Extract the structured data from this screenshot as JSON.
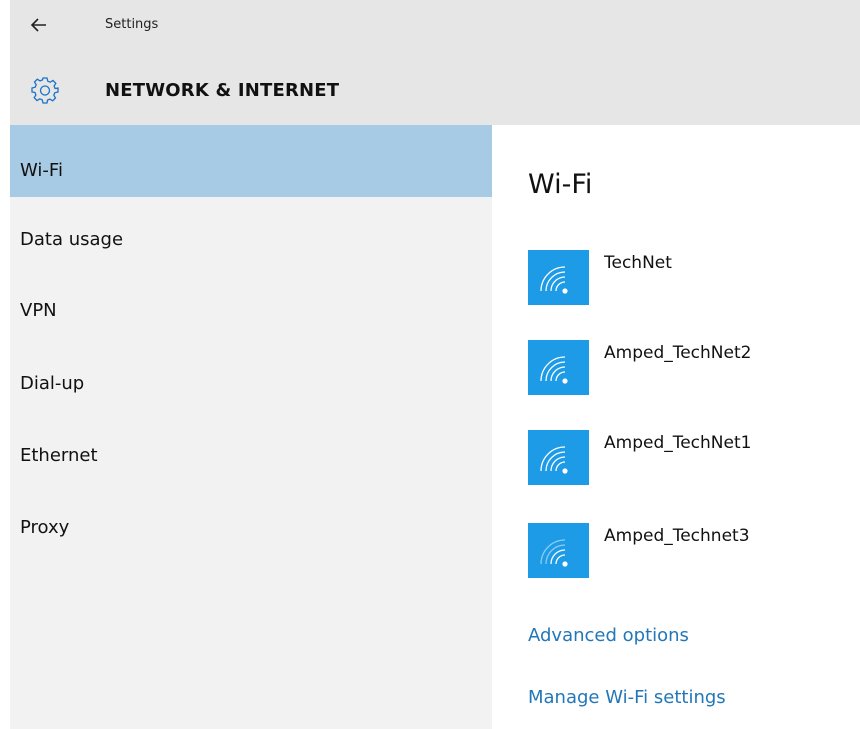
{
  "window": {
    "title": "Settings"
  },
  "header": {
    "page_title": "NETWORK & INTERNET"
  },
  "nav": {
    "items": [
      {
        "label": "Wi-Fi",
        "selected": true
      },
      {
        "label": "Data usage",
        "selected": false
      },
      {
        "label": "VPN",
        "selected": false
      },
      {
        "label": "Dial-up",
        "selected": false
      },
      {
        "label": "Ethernet",
        "selected": false
      },
      {
        "label": "Proxy",
        "selected": false
      }
    ]
  },
  "main": {
    "title": "Wi-Fi",
    "networks": [
      {
        "name": "TechNet",
        "signal_bars": 4,
        "icon": "wifi-signal-icon"
      },
      {
        "name": "Amped_TechNet2",
        "signal_bars": 4,
        "icon": "wifi-signal-icon"
      },
      {
        "name": "Amped_TechNet1",
        "signal_bars": 4,
        "icon": "wifi-signal-icon"
      },
      {
        "name": "Amped_Technet3",
        "signal_bars": 2,
        "icon": "wifi-signal-icon"
      }
    ],
    "links": {
      "advanced": "Advanced options",
      "manage": "Manage Wi-Fi settings"
    }
  },
  "colors": {
    "header_bg": "#e6e6e6",
    "nav_bg": "#f2f2f2",
    "nav_selected_bg": "#a7cbe4",
    "wifi_tile": "#1e9be7",
    "link": "#2277b9"
  },
  "icons": {
    "back": "back-arrow-icon",
    "settings": "gear-icon"
  }
}
